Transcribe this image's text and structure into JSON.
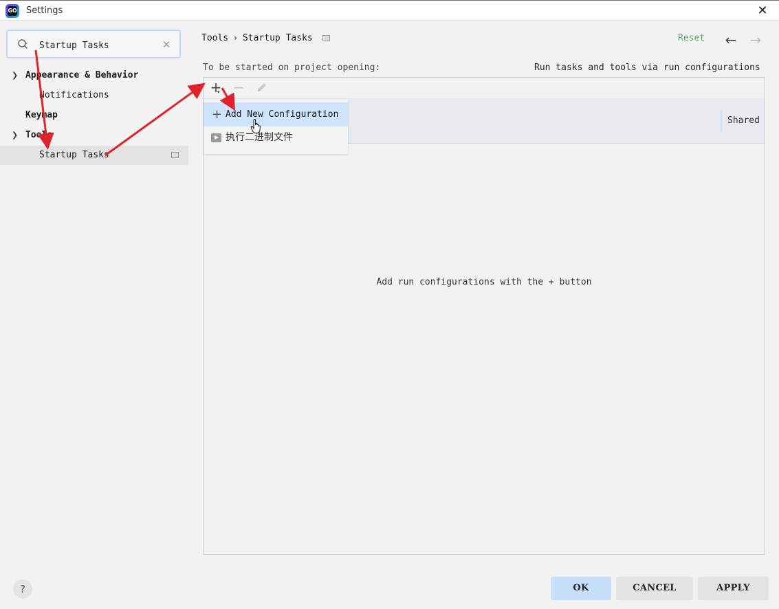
{
  "window": {
    "title": "Settings",
    "logo_text": "GO",
    "close_glyph": "✕"
  },
  "sidebar": {
    "search": {
      "value": "Startup Tasks",
      "clear_glyph": "✕"
    },
    "tree": [
      {
        "label": "Appearance & Behavior",
        "expanded": true
      },
      {
        "label": "Notifications"
      },
      {
        "label": "Keymap"
      },
      {
        "label": "Tools",
        "expanded": true
      },
      {
        "label": "Startup Tasks",
        "selected": true
      }
    ],
    "help_label": "?"
  },
  "header": {
    "breadcrumb": [
      "Tools",
      "Startup Tasks"
    ],
    "breadcrumb_separator": "›",
    "reset_label": "Reset",
    "back_glyph": "←",
    "forward_glyph": "→"
  },
  "main": {
    "startup_label": "To be started on project opening:",
    "run_tools_label": "Run tasks and tools via run configurations",
    "toolbar": {
      "add_glyph": "+",
      "add_caret": "▾",
      "remove_glyph": "−"
    },
    "table": {
      "shared_column": "Shared"
    },
    "empty_message": "Add run configurations with the + button",
    "add_menu": {
      "items": [
        {
          "label": "Add New Configuration",
          "icon": "plus-icon",
          "highlighted": true
        },
        {
          "label": "执行二进制文件",
          "icon": "run-icon"
        }
      ]
    }
  },
  "footer": {
    "ok_label": "OK",
    "cancel_label": "CANCEL",
    "apply_label": "APPLY"
  },
  "colors": {
    "accent_reset": "#59a869",
    "highlight": "#cde4fa",
    "ok_button": "#c6e0fa",
    "annotation_arrows": "#e0222a"
  }
}
